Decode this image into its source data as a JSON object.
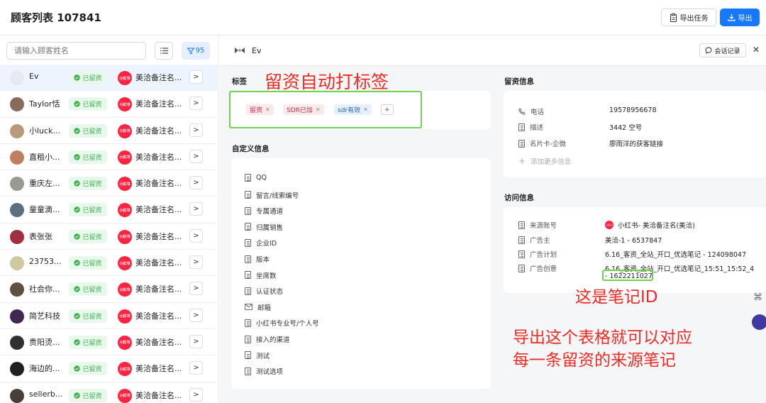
{
  "header": {
    "title": "顾客列表 107841",
    "tasks_label": "导出任务",
    "export_label": "导出"
  },
  "search": {
    "placeholder": "请输入顾客姓名"
  },
  "filter": {
    "count": "95"
  },
  "customers": [
    {
      "name": "Ev",
      "status": "已留资",
      "source": "美洽备注名...",
      "avatar_color": "#e8e8ee",
      "active": true
    },
    {
      "name": "Taylor恬",
      "status": "已留资",
      "source": "美洽备注名...",
      "avatar_color": "#8a6a5a"
    },
    {
      "name": "小luck...",
      "status": "已留资",
      "source": "美洽备注名...",
      "avatar_color": "#b89a7a"
    },
    {
      "name": "直租小...",
      "status": "已留资",
      "source": "美洽备注名...",
      "avatar_color": "#c08060"
    },
    {
      "name": "重庆左...",
      "status": "已留资",
      "source": "美洽备注名...",
      "avatar_color": "#9a9a90"
    },
    {
      "name": "童童滴...",
      "status": "已留资",
      "source": "美洽备注名...",
      "avatar_color": "#5a7080"
    },
    {
      "name": "表张张",
      "status": "已留资",
      "source": "美洽备注名...",
      "avatar_color": "#a03040"
    },
    {
      "name": "23753...",
      "status": "已留资",
      "source": "美洽备注名...",
      "avatar_color": "#d0c8a0"
    },
    {
      "name": "社会你...",
      "status": "已留资",
      "source": "美洽备注名...",
      "avatar_color": "#605040"
    },
    {
      "name": "简艺科技",
      "status": "已留资",
      "source": "美洽备注名...",
      "avatar_color": "#402850"
    },
    {
      "name": "贵阳烫...",
      "status": "已留资",
      "source": "美洽备注名...",
      "avatar_color": "#303030"
    },
    {
      "name": "海边的...",
      "status": "已留资",
      "source": "美洽备注名...",
      "avatar_color": "#202020"
    },
    {
      "name": "sellerb...",
      "status": "已留资",
      "source": "美洽备注名...",
      "avatar_color": "#484038"
    }
  ],
  "xhs_badge": "小红书",
  "detail": {
    "name": "Ev",
    "chat_label": "会话记录",
    "tags_title": "标签",
    "tags": [
      {
        "label": "留资",
        "bg": "#fde8ec",
        "color": "#c0304a"
      },
      {
        "label": "SDR已加",
        "bg": "#fde8ec",
        "color": "#c0304a"
      },
      {
        "label": "sdr有效",
        "bg": "#e6f0ff",
        "color": "#2a5fc0"
      }
    ],
    "custom_title": "自定义信息",
    "custom_fields": [
      {
        "label": "QQ",
        "icon": "doc-icon"
      },
      {
        "label": "留言/线索编号",
        "icon": "doc-icon"
      },
      {
        "label": "专属通道",
        "icon": "doc-icon"
      },
      {
        "label": "归属销售",
        "icon": "doc-icon"
      },
      {
        "label": "企业ID",
        "icon": "doc-icon"
      },
      {
        "label": "版本",
        "icon": "doc-icon"
      },
      {
        "label": "坐席数",
        "icon": "doc-icon"
      },
      {
        "label": "认证状态",
        "icon": "doc-icon"
      },
      {
        "label": "邮箱",
        "icon": "mail-icon"
      },
      {
        "label": "小红书专业号/个人号",
        "icon": "doc-icon"
      },
      {
        "label": "接入的渠道",
        "icon": "doc-icon"
      },
      {
        "label": "测试",
        "icon": "doc-icon"
      },
      {
        "label": "测试选项",
        "icon": "doc-icon"
      }
    ],
    "lead_title": "留资信息",
    "lead": {
      "phone_label": "电话",
      "phone": "19578956678",
      "desc_label": "描述",
      "desc": "3442 空号",
      "card_label": "名片卡-企微",
      "card": "廖雨洋的获客链接",
      "add_more": "添加更多信息"
    },
    "visit_title": "访问信息",
    "visit": {
      "account_label": "来源账号",
      "account": "小红书- 美洽备注名(美洽)",
      "advertiser_label": "广告主",
      "advertiser": "美洽-1 - 6537847",
      "plan_label": "广告计划",
      "plan": "6.16_客资_全站_开口_优选笔记 - 124098047",
      "creative_label": "广告创意",
      "creative_line1": "6.16_客资_全站_开口_优选笔记_15:51_15:52_4",
      "creative_line2": "- 1622211027"
    }
  },
  "annotations": {
    "tag_note": "留资自动打标签",
    "note_id": "这是笔记ID",
    "export_note_1": "导出这个表格就可以对应",
    "export_note_2": "每一条留资的来源笔记"
  }
}
